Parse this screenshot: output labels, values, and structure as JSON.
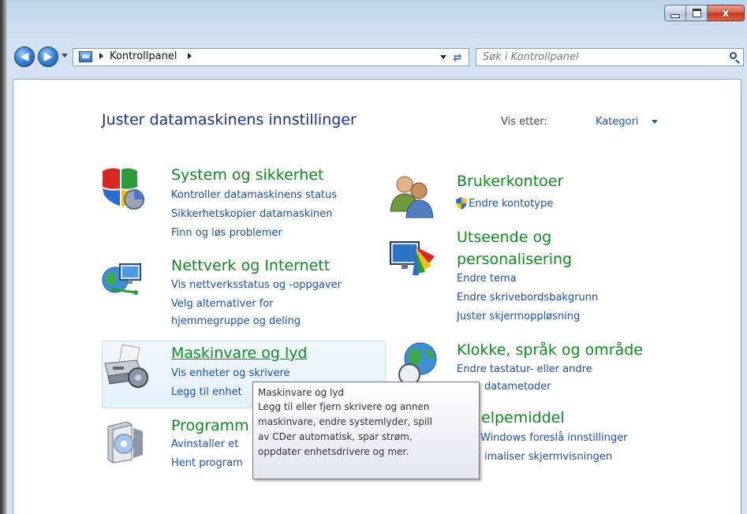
{
  "window": {
    "controls": {
      "minimize": "minimize",
      "maximize": "maximize",
      "close": "x"
    }
  },
  "navbar": {
    "breadcrumb": "Kontrollpanel",
    "search_placeholder": "Søk i Kontrollpanel"
  },
  "header": {
    "title": "Juster datamaskinens innstillinger",
    "view_by_label": "Vis etter:",
    "view_by_value": "Kategori"
  },
  "categories": {
    "system": {
      "title": "System og sikkerhet",
      "links": [
        "Kontroller datamaskinens status",
        "Sikkerhetskopier datamaskinen",
        "Finn og løs problemer"
      ]
    },
    "network": {
      "title": "Nettverk og Internett",
      "links": [
        "Vis nettverksstatus og -oppgaver",
        "Velg alternativer for",
        "hjemmegruppe og deling"
      ]
    },
    "hardware": {
      "title": "Maskinvare og lyd",
      "links": [
        "Vis enheter og skrivere",
        "Legg til enhet"
      ]
    },
    "programs": {
      "title": "Programm",
      "links": [
        "Avinstaller et",
        "Hent program"
      ]
    },
    "users": {
      "title": "Brukerkontoer",
      "links": [
        "Endre kontotype"
      ]
    },
    "appearance": {
      "title_line1": "Utseende og",
      "title_line2": "personalisering",
      "links": [
        "Endre tema",
        "Endre skrivebordsbakgrunn",
        "Juster skjermoppløsning"
      ]
    },
    "clock": {
      "title": "Klokke, språk og område",
      "links": [
        "Endre tastatur- eller andre",
        "datametoder"
      ]
    },
    "ease": {
      "title": "elpemiddel",
      "links": [
        "Windows foreslå innstillinger",
        "imaliser skjermvisningen"
      ]
    }
  },
  "tooltip": {
    "title": "Maskinvare og lyd",
    "lines": [
      "Legg til eller fjern skrivere og annen",
      "maskinvare, endre systemlyder, spill",
      "av CDer automatisk, spar strøm,",
      "oppdater enhetsdrivere og mer."
    ]
  },
  "colors": {
    "category_title": "#118a1e",
    "link": "#1b51a8",
    "page_title": "#1e3287"
  }
}
